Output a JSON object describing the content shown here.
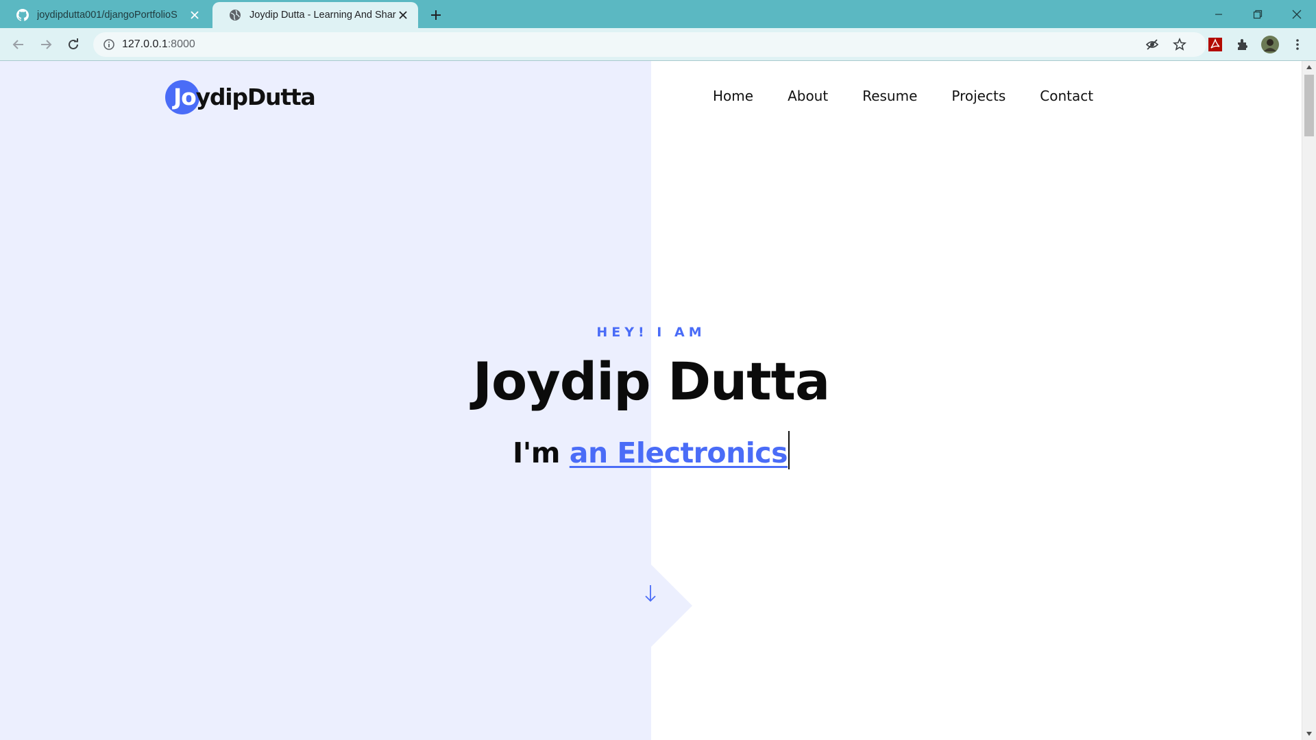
{
  "browser": {
    "tabs": [
      {
        "title": "joydipdutta001/djangoPortfolioS",
        "icon": "github-icon",
        "active": false
      },
      {
        "title": "Joydip Dutta - Learning And Shar",
        "icon": "globe-icon",
        "active": true
      }
    ],
    "address": {
      "host": "127.0.0.1",
      "port": ":8000"
    }
  },
  "site": {
    "logo": {
      "lead": "Jo",
      "rest": "ydipDutta"
    },
    "nav": [
      "Home",
      "About",
      "Resume",
      "Projects",
      "Contact"
    ],
    "hero": {
      "kicker": "HEY! I AM",
      "name": "Joydip Dutta",
      "typed_prefix": "I'm ",
      "typed_text": "an Electronics"
    }
  },
  "colors": {
    "accent": "#4a6cf7",
    "hero_left_bg": "#eceffe",
    "tabstrip": "#5bb8c2",
    "toolbar": "#dff2f4"
  }
}
